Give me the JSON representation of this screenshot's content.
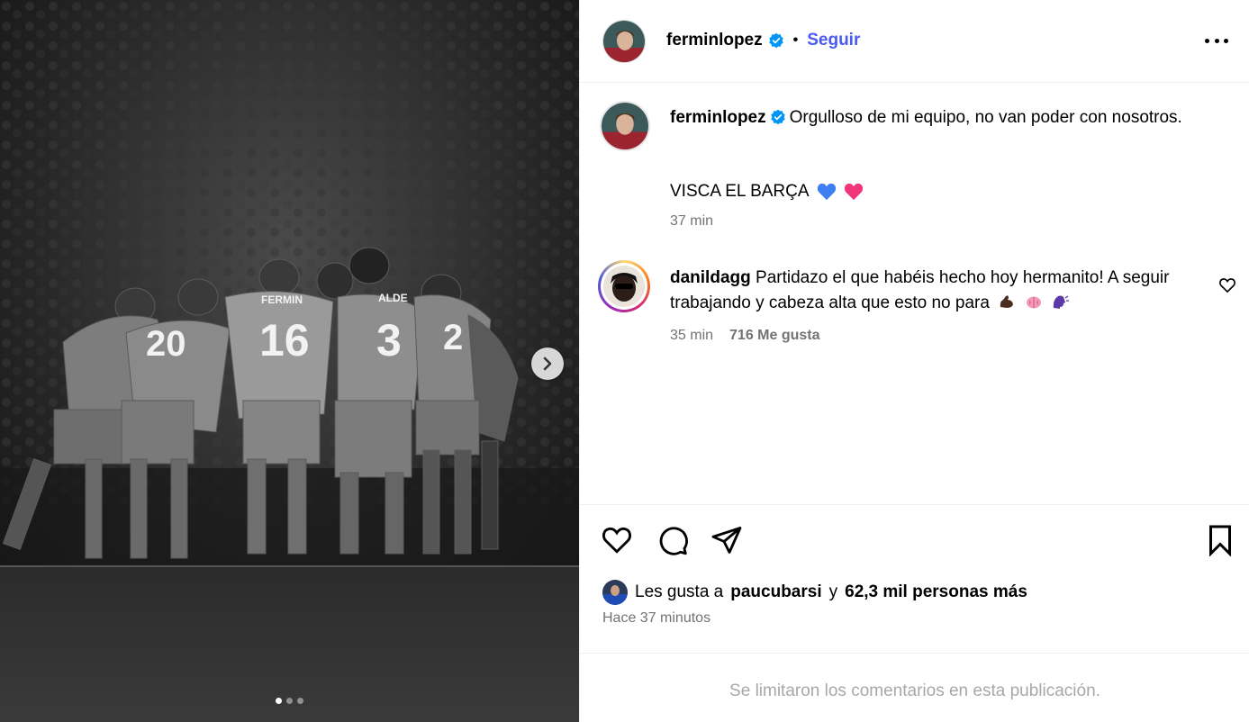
{
  "post": {
    "author": "ferminlopez",
    "follow_label": "Seguir",
    "separator": "•",
    "caption_text": "Orgulloso de mi equipo, no van poder con nosotros.",
    "caption_line2": "VISCA EL BARÇA",
    "caption_time": "37 min",
    "image": {
      "jersey_numbers": [
        "16",
        "3",
        "20",
        "2"
      ],
      "jersey_names": [
        "FERMIN",
        "ALDE"
      ],
      "carousel": {
        "current": 1,
        "total": 3
      }
    }
  },
  "comment": {
    "author": "danildagg",
    "text": "Partidazo el que habéis hecho hoy hermanito! A seguir trabajando y cabeza alta que esto no para",
    "emojis": [
      "muscle-icon",
      "brain-icon",
      "speaking-head-icon"
    ],
    "time": "35 min",
    "likes": "716 Me gusta"
  },
  "engagement": {
    "liked_by_prefix": "Les gusta a",
    "liked_by_user": "paucubarsi",
    "liked_by_conj": "y",
    "liked_by_others": "62,3 mil personas más",
    "posted_ago": "Hace 37 minutos"
  },
  "footer": {
    "limited_comments": "Se limitaron los comentarios en esta publicación."
  },
  "colors": {
    "follow": "#4a5bef",
    "verified": "#0095f6",
    "muted": "#737373",
    "blue_heart": "#3d7ef0",
    "pink_heart": "#f0357a"
  }
}
